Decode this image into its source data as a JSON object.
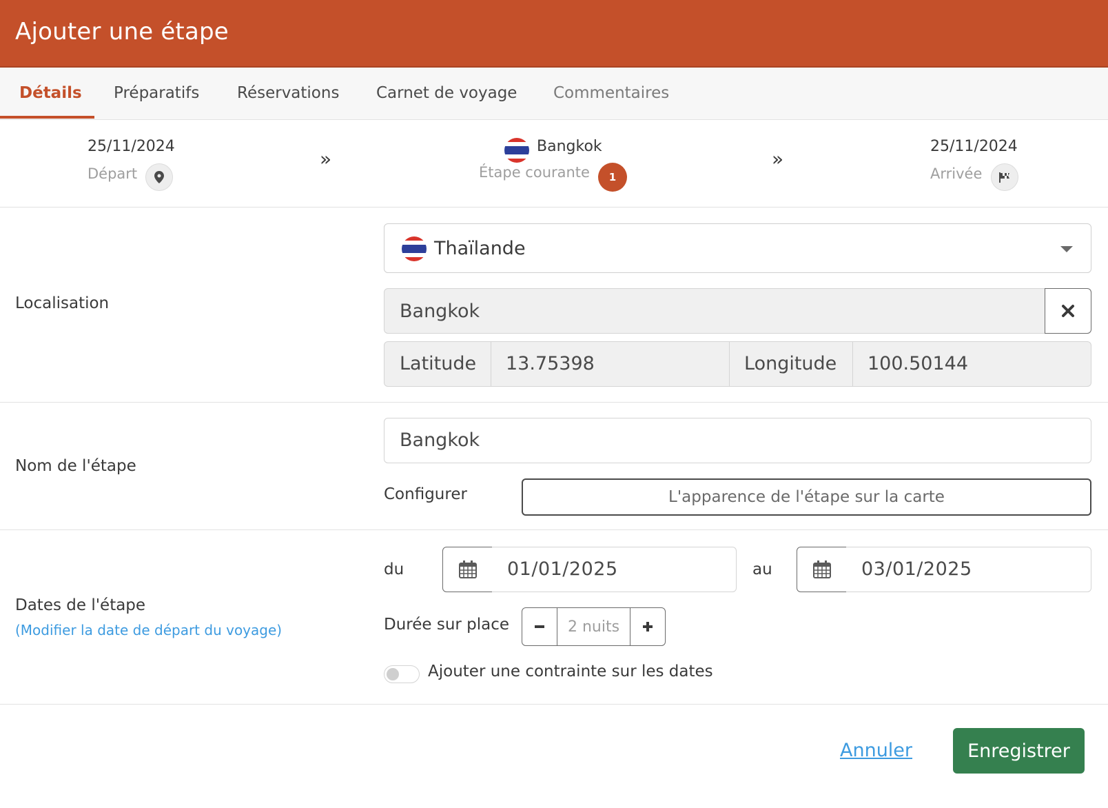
{
  "header": {
    "title": "Ajouter une étape"
  },
  "tabs": [
    {
      "label": "Détails",
      "active": true
    },
    {
      "label": "Préparatifs"
    },
    {
      "label": "Réservations"
    },
    {
      "label": "Carnet de voyage"
    },
    {
      "label": "Commentaires"
    }
  ],
  "step_nav": {
    "departure": {
      "date": "25/11/2024",
      "label": "Départ",
      "icon": "map-marker-icon"
    },
    "current": {
      "city": "Bangkok",
      "label": "Étape courante",
      "badge": "1",
      "flag": "thailand-flag"
    },
    "arrival": {
      "date": "25/11/2024",
      "label": "Arrivée",
      "icon": "flag-checkered-icon"
    },
    "separator": "»"
  },
  "location": {
    "label": "Localisation",
    "country": "Thaïlande",
    "city": "Bangkok",
    "latitude_label": "Latitude",
    "latitude": "13.75398",
    "longitude_label": "Longitude",
    "longitude": "100.50144"
  },
  "step_name": {
    "label": "Nom de l'étape",
    "value": "Bangkok",
    "configure_label": "Configurer",
    "configure_button": "L'apparence de l'étape sur la carte"
  },
  "dates": {
    "label": "Dates de l'étape",
    "link": "(Modifier la date de départ du voyage)",
    "from_label": "du",
    "from": "01/01/2025",
    "to_label": "au",
    "to": "03/01/2025",
    "duration_label": "Durée sur place",
    "duration": "2 nuits",
    "constraint_label": "Ajouter une contrainte sur les dates",
    "constraint_enabled": false
  },
  "footer": {
    "cancel": "Annuler",
    "save": "Enregistrer"
  },
  "colors": {
    "brand": "#c4502a",
    "save": "#35804f",
    "link": "#3d9be0"
  }
}
